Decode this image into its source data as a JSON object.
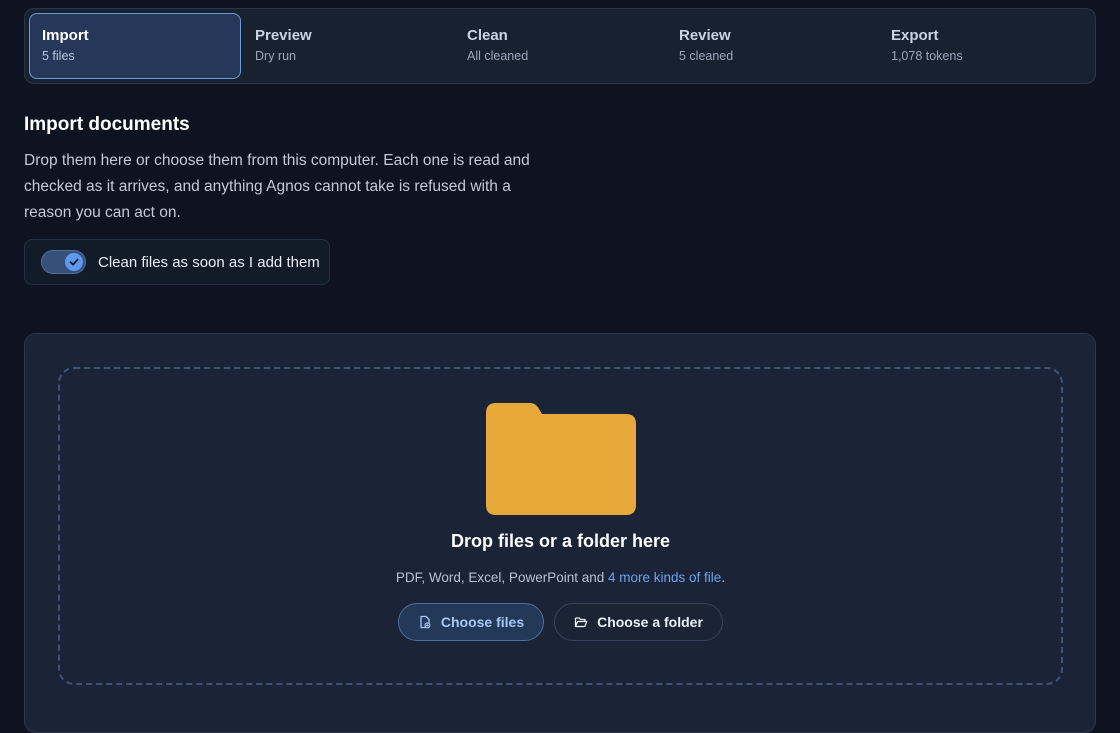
{
  "stepper": {
    "steps": [
      {
        "label": "Import",
        "sub": "5 files"
      },
      {
        "label": "Preview",
        "sub": "Dry run"
      },
      {
        "label": "Clean",
        "sub": "All cleaned"
      },
      {
        "label": "Review",
        "sub": "5 cleaned"
      },
      {
        "label": "Export",
        "sub": "1,078 tokens"
      }
    ],
    "active_index": 0
  },
  "main": {
    "title": "Import documents",
    "description": "Drop them here or choose them from this computer. Each one is read and checked as it arrives, and anything Agnos cannot take is refused with a reason you can act on."
  },
  "toggle": {
    "label": "Clean files as soon as I add them",
    "checked": true
  },
  "dropzone": {
    "title": "Drop files or a folder here",
    "formats_prefix": "PDF, Word, Excel, PowerPoint and ",
    "formats_link": "4 more kinds of file",
    "formats_suffix": ".",
    "choose_files_label": "Choose files",
    "choose_folder_label": "Choose a folder"
  },
  "colors": {
    "accent": "#6ea2f2",
    "folder": "#e8a93b",
    "background": "#0d1320"
  },
  "icons": {
    "folder": "folder-icon",
    "choose_files": "file-plus-icon",
    "choose_folder": "folder-open-icon",
    "toggle": "check-icon"
  }
}
